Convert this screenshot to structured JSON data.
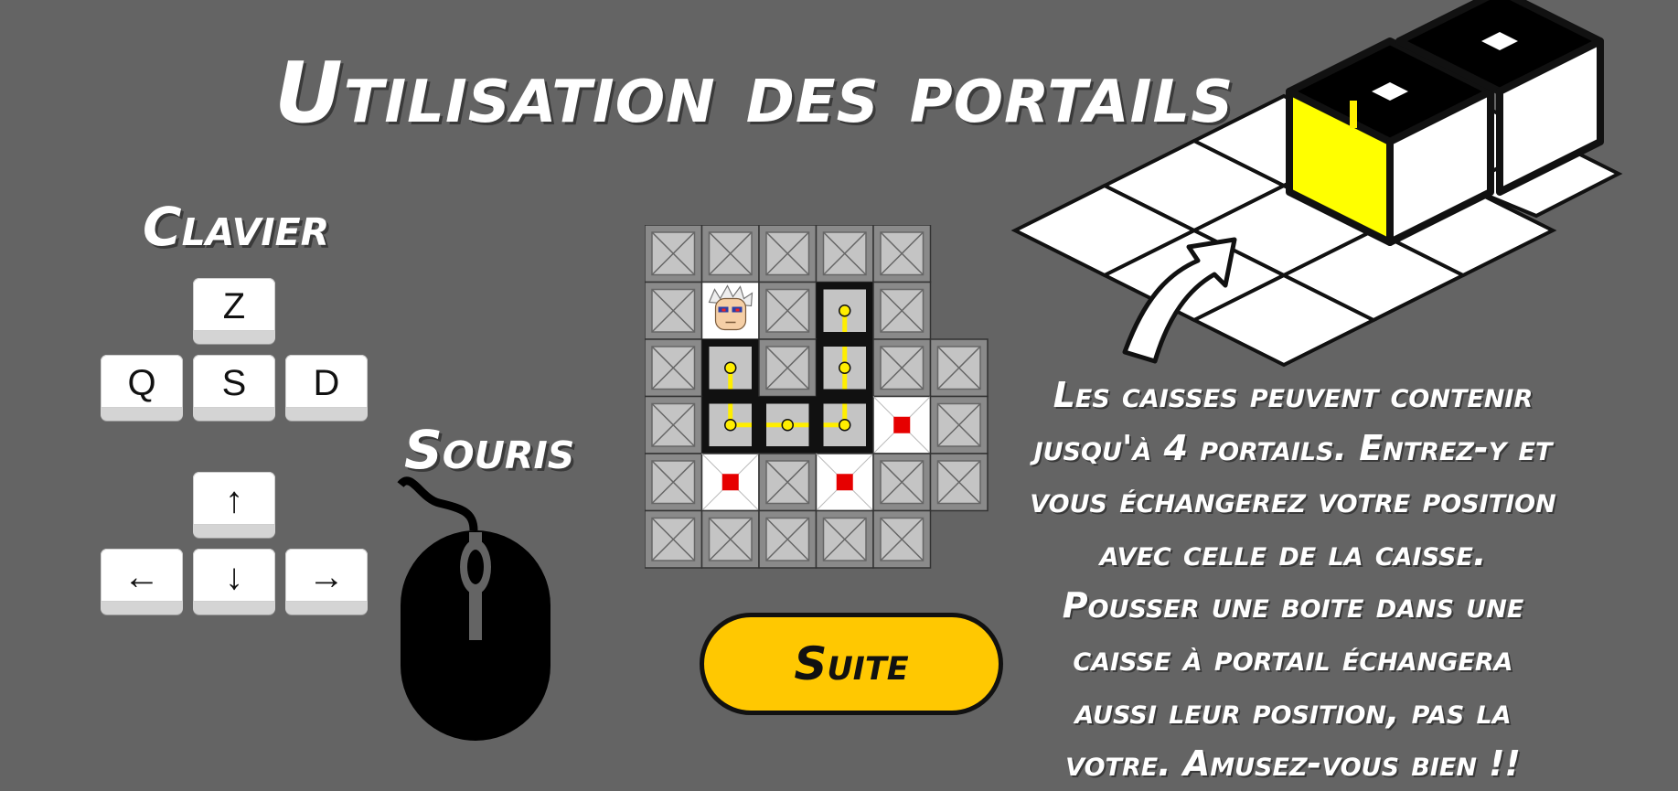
{
  "title": "Utilisation des portails",
  "keyboard": {
    "heading": "Clavier",
    "letter_keys": [
      "Z",
      "Q",
      "S",
      "D"
    ],
    "arrow_keys": [
      "↑",
      "←",
      "↓",
      "→"
    ]
  },
  "mouse": {
    "heading": "Souris",
    "icon": "mouse-icon"
  },
  "next_button": {
    "label": "Suite"
  },
  "description": [
    "Les caisses peuvent contenir",
    "jusqu'à 4 portails. Entrez-y et",
    "vous échangerez votre position",
    "avec celle de la caisse.",
    "Pousser une boite dans une",
    "caisse à portail échangera",
    "aussi leur position, pas la",
    "votre. Amusez-vous bien !!"
  ],
  "colors": {
    "background": "#646464",
    "button": "#ffc801",
    "portal": "#ffee00",
    "goal": "#e60000",
    "box": "#bdbdbd"
  },
  "board": {
    "rows": [
      [
        "box",
        "box",
        "box",
        "box",
        "box",
        "empty"
      ],
      [
        "box",
        "player",
        "box",
        "wall",
        "box",
        "empty"
      ],
      [
        "box",
        "wall",
        "box",
        "wall",
        "box",
        "box"
      ],
      [
        "box",
        "wall",
        "wall",
        "wall",
        "goal",
        "box"
      ],
      [
        "box",
        "goal",
        "box",
        "goal",
        "box",
        "box"
      ],
      [
        "box",
        "box",
        "box",
        "box",
        "box",
        "empty"
      ]
    ]
  }
}
